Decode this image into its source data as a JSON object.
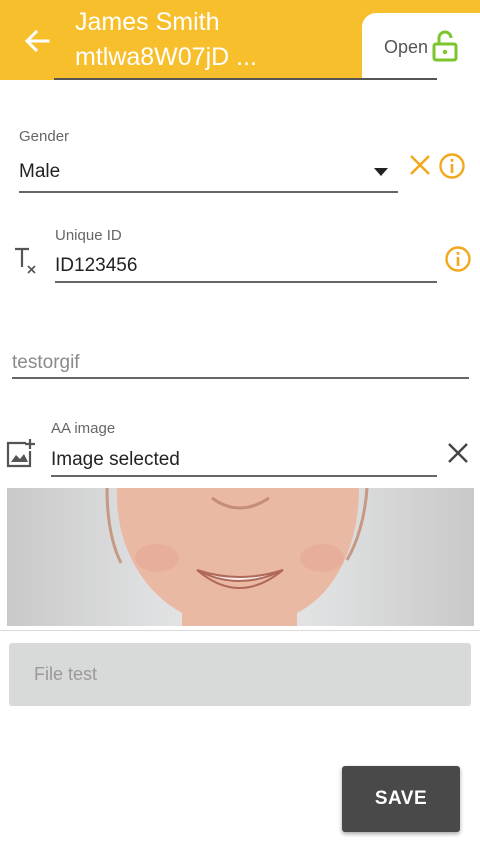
{
  "header": {
    "title": "James Smith",
    "subtitle": "mtlwa8W07jD ...",
    "status_label": "Open",
    "back_icon": "arrow-left-icon",
    "status_icon": "unlocked-padlock-icon",
    "color": "#f7bf2c",
    "status_icon_color": "#7bc62d"
  },
  "gender": {
    "label": "Gender",
    "value": "Male"
  },
  "unique_id": {
    "label": "Unique ID",
    "value": "ID123456"
  },
  "testorgif": {
    "placeholder": "testorgif"
  },
  "aa_image": {
    "label": "AA image",
    "value": "Image selected"
  },
  "file_test": {
    "label": "File test"
  },
  "actions": {
    "save_label": "SAVE"
  },
  "colors": {
    "accent": "#f2a81d",
    "save_button": "#494949"
  }
}
